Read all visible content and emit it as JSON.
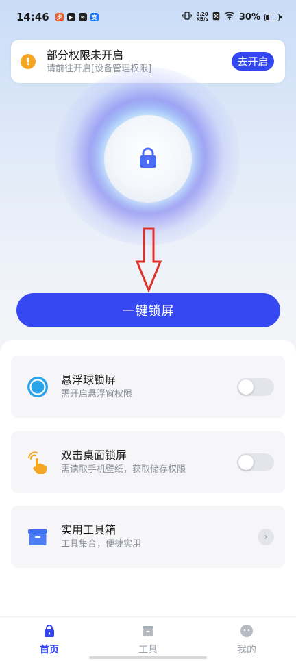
{
  "status_bar": {
    "time": "14:46",
    "apps": [
      {
        "name": "app-icon-1",
        "glyph": "步",
        "color": "#f05a28"
      },
      {
        "name": "app-icon-2",
        "glyph": "▶",
        "color": "#222222"
      },
      {
        "name": "app-icon-3",
        "glyph": "∞",
        "color": "#222222"
      },
      {
        "name": "app-icon-4",
        "glyph": "支",
        "color": "#1677ff"
      }
    ],
    "net_speed_value": "0.20",
    "net_speed_unit": "KB/s",
    "battery": "30%",
    "battery_level": 0.3
  },
  "permission_banner": {
    "title": "部分权限未开启",
    "subtitle": "请前往开启[设备管理权限]",
    "button": "去开启"
  },
  "main": {
    "lock_button": "一键锁屏"
  },
  "features": [
    {
      "title": "悬浮球锁屏",
      "subtitle": "需开启悬浮窗权限",
      "control": "toggle",
      "on": false
    },
    {
      "title": "双击桌面锁屏",
      "subtitle": "需读取手机壁纸，获取储存权限",
      "control": "toggle",
      "on": false
    },
    {
      "title": "实用工具箱",
      "subtitle": "工具集合，便捷实用",
      "control": "chevron"
    }
  ],
  "bottom_nav": {
    "items": [
      {
        "label": "首页",
        "active": true
      },
      {
        "label": "工具",
        "active": false
      },
      {
        "label": "我的",
        "active": false
      }
    ]
  },
  "colors": {
    "accent": "#3347f0",
    "warning": "#f5a623",
    "arrow_red": "#e0302a"
  }
}
